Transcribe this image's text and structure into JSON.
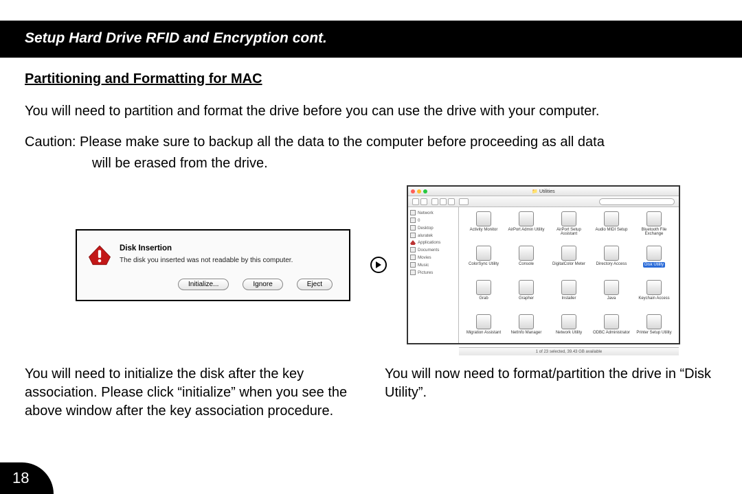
{
  "page_number": "18",
  "title": "Setup Hard Drive RFID and Encryption cont.",
  "section_heading": "Partitioning and Formatting for MAC",
  "intro": "You will need to partition and format the drive before you can use the drive with your computer.",
  "caution_line1": "Caution: Please make sure to backup all the data to the computer before proceeding as all data",
  "caution_line2": "will be erased from the drive.",
  "dialog": {
    "title": "Disk Insertion",
    "message": "The disk you inserted was not readable by this computer.",
    "buttons": {
      "initialize": "Initialize...",
      "ignore": "Ignore",
      "eject": "Eject"
    }
  },
  "utilities": {
    "window_title": "Utilities",
    "status": "1 of 23 selected, 39.43 GB available",
    "sidebar": [
      "Network",
      "0",
      "Desktop",
      "aluratek",
      "Applications",
      "Documents",
      "Movies",
      "Music",
      "Pictures"
    ],
    "items": [
      "Activity Monitor",
      "AirPort Admin Utility",
      "AirPort Setup Assistant",
      "Audio MIDI Setup",
      "Bluetooth File Exchange",
      "ColorSync Utility",
      "Console",
      "DigitalColor Meter",
      "Directory Access",
      "Disk Utility",
      "Grab",
      "Grapher",
      "Installer",
      "Java",
      "Keychain Access",
      "Migration Assistant",
      "NetInfo Manager",
      "Network Utility",
      "ODBC Administrator",
      "Printer Setup Utility"
    ],
    "selected_index": 9
  },
  "left_text": "You will need to initialize the disk after the key association. Please click “initialize” when you see the above window after the key association procedure.",
  "right_text": "You will now need to format/partition the drive in “Disk Utility”."
}
